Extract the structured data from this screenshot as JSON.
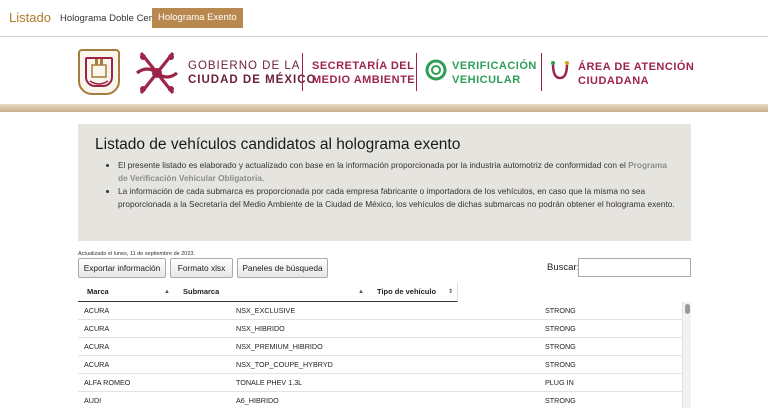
{
  "nav": {
    "brand": "Listado",
    "links": [
      "Holograma Doble Cero",
      "Holograma Exento"
    ]
  },
  "header": {
    "gobierno_line1": "GOBIERNO DE LA",
    "gobierno_line2": "CIUDAD DE MÉXICO",
    "secretaria_line1": "SECRETARÍA DEL",
    "secretaria_line2": "MEDIO AMBIENTE",
    "verificacion_line1": "VERIFICACIÓN",
    "verificacion_line2": "VEHICULAR",
    "atencion_line1": "ÁREA DE ATENCIÓN",
    "atencion_line2": "CIUDADANA"
  },
  "info": {
    "title": "Listado de vehículos candidatos al holograma exento",
    "bullet1_text": "El presente listado es elaborado y actualizado con base en la información proporcionada por la industria automotriz de conformidad con el",
    "bullet1_link": "Programa de Verificación Vehicular Obligatoria",
    "bullet1_end": ".",
    "bullet2": "La información de cada submarca es proporcionada por cada empresa fabricante o importadora de los vehículos, en caso que la misma no sea proporcionada a la Secretaría del Medio Ambiente de la Ciudad de México, los vehículos de dichas submarcas no podrán obtener el holograma exento."
  },
  "updated": "Actualizado el lunes, 11 de septiembre de 2023.",
  "buttons": {
    "export": "Exportar información",
    "xlsx": "Formato xlsx",
    "panels": "Paneles de búsqueda"
  },
  "search": {
    "label": "Buscar:",
    "value": ""
  },
  "table": {
    "headers": [
      "Marca",
      "Submarca",
      "Tipo de vehículo"
    ],
    "rows": [
      [
        "ACURA",
        "NSX_EXCLUSIVE",
        "STRONG"
      ],
      [
        "ACURA",
        "NSX_HIBRIDO",
        "STRONG"
      ],
      [
        "ACURA",
        "NSX_PREMIUM_HIBRIDO",
        "STRONG"
      ],
      [
        "ACURA",
        "NSX_TOP_COUPE_HYBRYD",
        "STRONG"
      ],
      [
        "ALFA ROMEO",
        "TONALE PHEV 1.3L",
        "PLUG IN"
      ],
      [
        "AUDI",
        "A6_HIBRIDO",
        "STRONG"
      ]
    ]
  },
  "colors": {
    "gold": "#b8884e",
    "guinda": "#9d2449",
    "green": "#2e9f57",
    "infobox_bg": "#e6e4df"
  }
}
